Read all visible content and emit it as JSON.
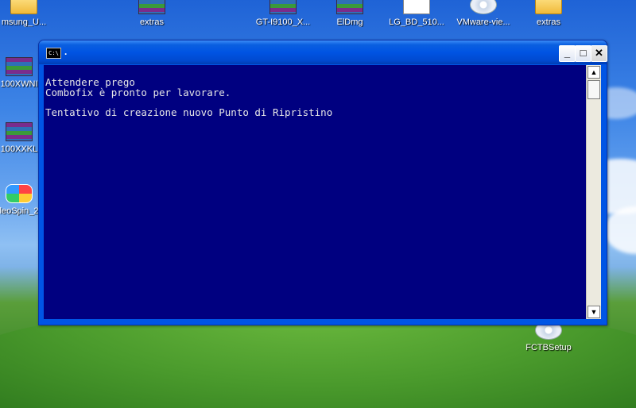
{
  "desktop": {
    "top_icons": [
      {
        "label": "msung_U...",
        "icon": "folder-icon"
      },
      {
        "label": "extras",
        "icon": "winrar-archive-icon"
      },
      {
        "label": "GT-I9100_X...",
        "icon": "winrar-archive-icon"
      },
      {
        "label": "ElDmg",
        "icon": "winrar-archive-icon"
      },
      {
        "label": "LG_BD_510...",
        "icon": "document-icon"
      },
      {
        "label": "VMware-vie...",
        "icon": "cd-installer-icon"
      },
      {
        "label": "extras",
        "icon": "folder-icon"
      }
    ],
    "left_icons": [
      {
        "label": "100XWNI",
        "icon": "winrar-archive-icon"
      },
      {
        "label": "100XXKL",
        "icon": "winrar-archive-icon"
      },
      {
        "label": "leoSpin_2",
        "icon": "app-icon"
      }
    ],
    "right_icon": {
      "label": "FCTBSetup",
      "icon": "cd-installer-icon"
    }
  },
  "window": {
    "title": ".",
    "title_icon_text": "C:\\",
    "buttons": {
      "minimize": "_",
      "maximize": "□",
      "close": "✕"
    },
    "console_lines": [
      "Attendere prego",
      "Combofix è pronto per lavorare.",
      "",
      "Tentativo di creazione nuovo Punto di Ripristino"
    ],
    "scrollbar": {
      "up": "▲",
      "down": "▼"
    }
  }
}
